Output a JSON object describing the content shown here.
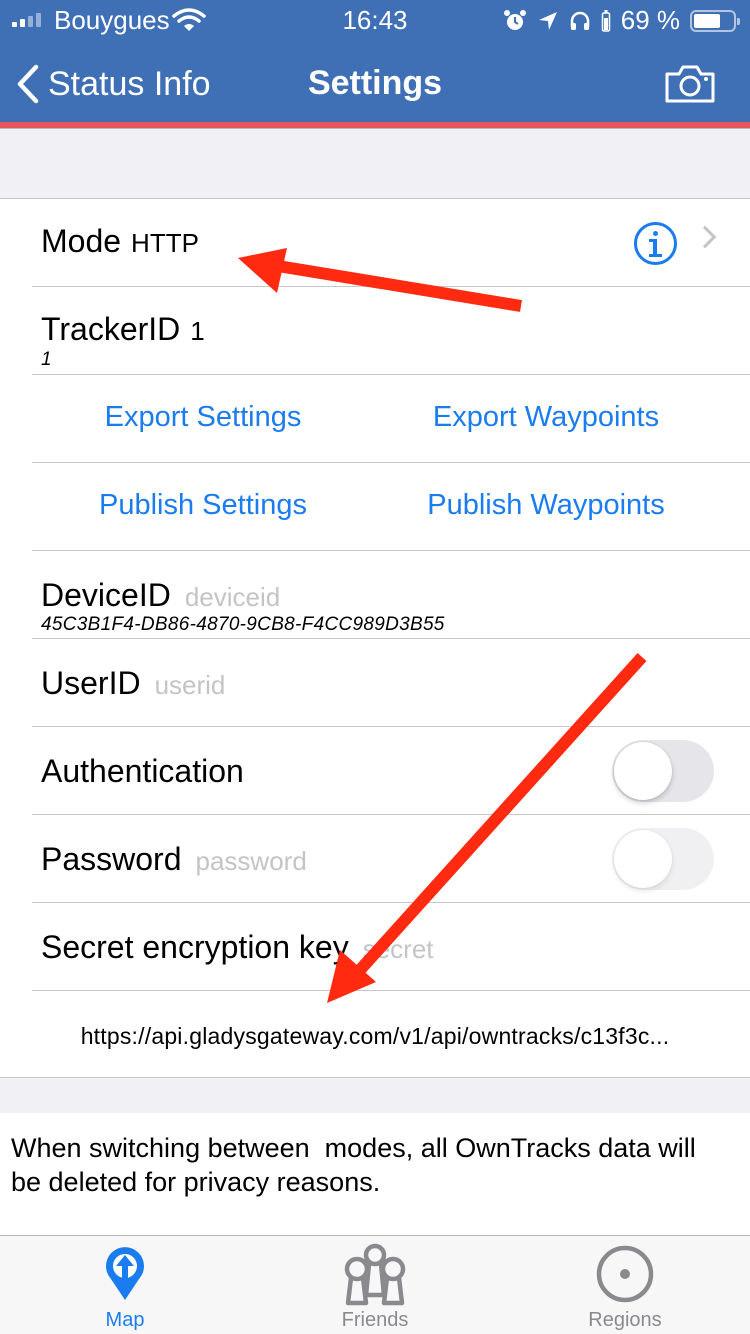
{
  "status_bar": {
    "carrier": "Bouygues",
    "time": "16:43",
    "battery_percent_label": "69 %",
    "battery_level": 0.69,
    "icons": [
      "signal-icon",
      "wifi-icon",
      "alarm-icon",
      "location-arrow-icon",
      "headphones-icon",
      "headphone-battery-icon",
      "battery-icon"
    ]
  },
  "nav": {
    "back_label": "Status Info",
    "title": "Settings",
    "right_icon": "camera-icon"
  },
  "colors": {
    "nav_background": "#3f6fb4",
    "nav_stripe": "#e8555a",
    "accent": "#1b7cf0",
    "annotation_arrow": "#ff2a10",
    "placeholder": "#c4c4c7"
  },
  "settings": {
    "mode": {
      "label": "Mode",
      "value": "HTTP"
    },
    "tracker_id": {
      "label": "TrackerID",
      "value": "1",
      "subtitle": "1"
    },
    "export_settings": "Export Settings",
    "export_waypoints": "Export Waypoints",
    "publish_settings": "Publish Settings",
    "publish_waypoints": "Publish Waypoints",
    "device_id": {
      "label": "DeviceID",
      "placeholder": "deviceid",
      "subtitle": "45C3B1F4-DB86-4870-9CB8-F4CC989D3B55"
    },
    "user_id": {
      "label": "UserID",
      "placeholder": "userid"
    },
    "authentication": {
      "label": "Authentication",
      "enabled": false
    },
    "password": {
      "label": "Password",
      "placeholder": "password",
      "enabled": false
    },
    "secret": {
      "label": "Secret encryption key",
      "placeholder": "secret"
    },
    "url": "https://api.gladysgateway.com/v1/api/owntracks/c13f3c..."
  },
  "footer_note": "When switching between  modes, all OwnTracks data will be deleted for privacy reasons.",
  "tabs": [
    {
      "label": "Map",
      "icon": "map-pin-arrow-icon",
      "active": true
    },
    {
      "label": "Friends",
      "icon": "friends-icon",
      "active": false
    },
    {
      "label": "Regions",
      "icon": "regions-target-icon",
      "active": false
    }
  ]
}
